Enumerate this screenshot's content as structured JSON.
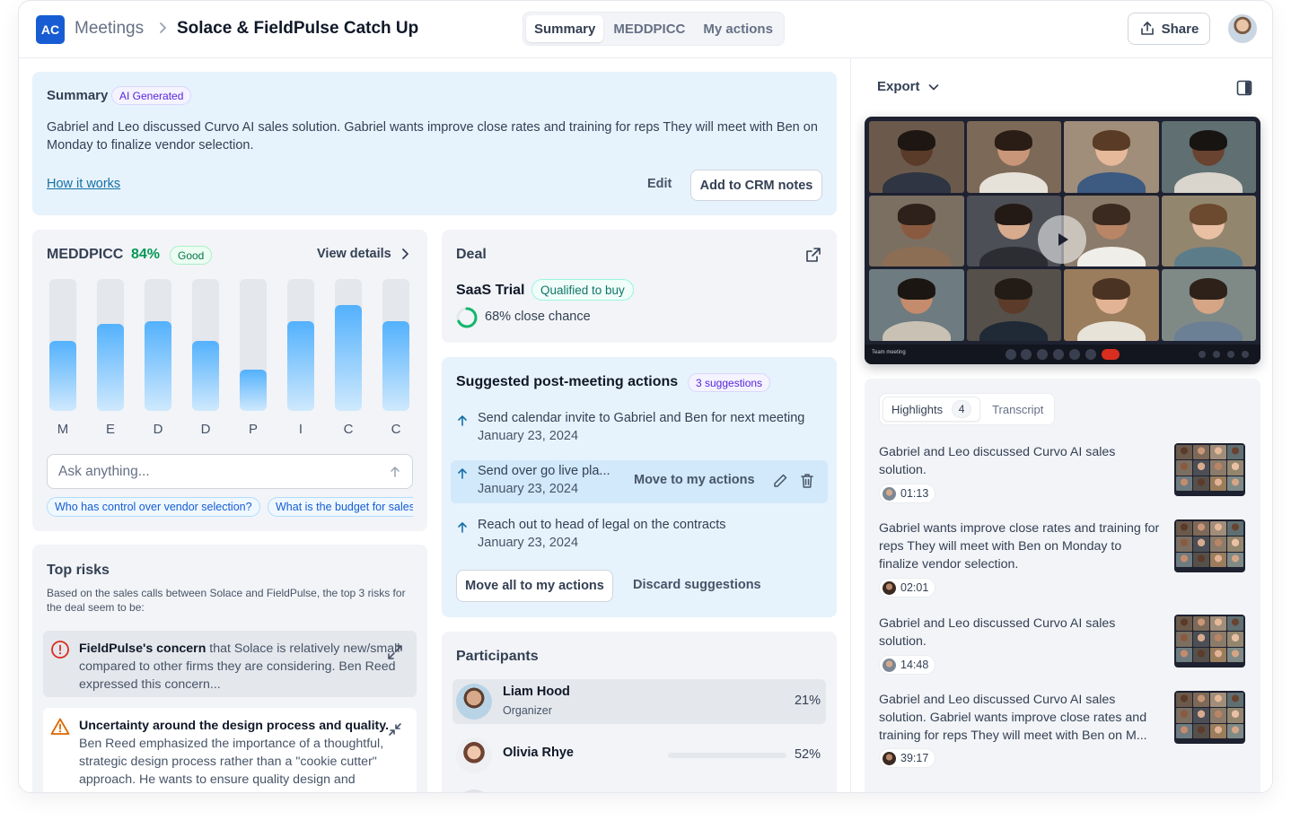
{
  "header": {
    "logo": "AC",
    "breadcrumb_root": "Meetings",
    "title": "Solace & FieldPulse Catch Up",
    "tabs": [
      {
        "label": "Summary",
        "active": true
      },
      {
        "label": "MEDDPICC",
        "active": false
      },
      {
        "label": "My actions",
        "active": false
      }
    ],
    "share_label": "Share"
  },
  "summary": {
    "title": "Summary",
    "badge": "AI Generated",
    "text": "Gabriel and Leo discussed Curvo AI sales solution. Gabriel wants improve close rates and training for reps They will meet with Ben on Monday to finalize vendor selection.",
    "how_link": "How it works",
    "edit_label": "Edit",
    "crm_label": "Add to CRM notes"
  },
  "meddpicc": {
    "title": "MEDDPICC",
    "score": "84%",
    "badge": "Good",
    "view_details": "View details",
    "accent": "#039855",
    "ask_placeholder": "Ask anything...",
    "chips": [
      "Who has control over vendor selection?",
      "What is the budget for sales"
    ]
  },
  "chart_data": {
    "type": "bar",
    "categories": [
      "M",
      "E",
      "D",
      "D",
      "P",
      "I",
      "C",
      "C"
    ],
    "values": [
      53,
      66,
      68,
      53,
      31,
      68,
      80,
      68
    ],
    "ylim": [
      0,
      100
    ],
    "title": "",
    "xlabel": "",
    "ylabel": ""
  },
  "risks": {
    "title": "Top risks",
    "subtitle": "Based on the sales calls between Solace and FieldPulse, the top 3 risks for the deal seem to be:",
    "items": [
      {
        "lead": "FieldPulse's concern",
        "text": " that Solace is relatively new/small compared to other firms they are considering. Ben Reed expressed this concern...",
        "icon": "alert-circle-icon",
        "color": "#d92d20"
      },
      {
        "lead": "Uncertainty around the design process and quality.",
        "text": " Ben Reed emphasized the importance of a thoughtful, strategic design process rather than a \"cookie cutter\" approach. He wants to ensure quality design and execution.",
        "icon": "alert-triangle-icon",
        "color": "#dc6803"
      }
    ]
  },
  "deal": {
    "title": "Deal",
    "name": "SaaS Trial",
    "status": "Qualified to buy",
    "close_chance": "68% close chance",
    "close_value": 0.68
  },
  "suggestions": {
    "title": "Suggested post-meeting actions",
    "badge": "3 suggestions",
    "items": [
      {
        "title": "Send calendar invite to Gabriel and Ben for next meeting",
        "date": "January 23, 2024"
      },
      {
        "title": "Send over go live pla...",
        "date": "January 23, 2024",
        "move_label": "Move to my actions"
      },
      {
        "title": "Reach out to head of legal on the contracts",
        "date": "January 23, 2024"
      }
    ],
    "move_all": "Move all to my actions",
    "discard": "Discard suggestions"
  },
  "participants": {
    "title": "Participants",
    "items": [
      {
        "name": "Liam Hood",
        "role": "Organizer",
        "pct": "21%"
      },
      {
        "name": "Olivia Rhye",
        "role": "",
        "pct": "52%"
      }
    ]
  },
  "right": {
    "export_label": "Export",
    "video_footer": "Team meeting",
    "tabs": [
      {
        "label": "Highlights",
        "count": "4",
        "active": true
      },
      {
        "label": "Transcript",
        "active": false
      }
    ],
    "highlights": [
      {
        "text": "Gabriel and Leo discussed Curvo AI sales solution.",
        "time": "01:13"
      },
      {
        "text": "Gabriel wants improve close rates and training for reps They will meet with Ben on Monday to finalize vendor selection.",
        "time": "02:01"
      },
      {
        "text": "Gabriel and Leo discussed Curvo AI sales solution.",
        "time": "14:48"
      },
      {
        "text": "Gabriel and Leo discussed Curvo AI sales solution. Gabriel wants improve close rates and training for reps They will meet with Ben on M...",
        "time": "39:17"
      }
    ]
  }
}
